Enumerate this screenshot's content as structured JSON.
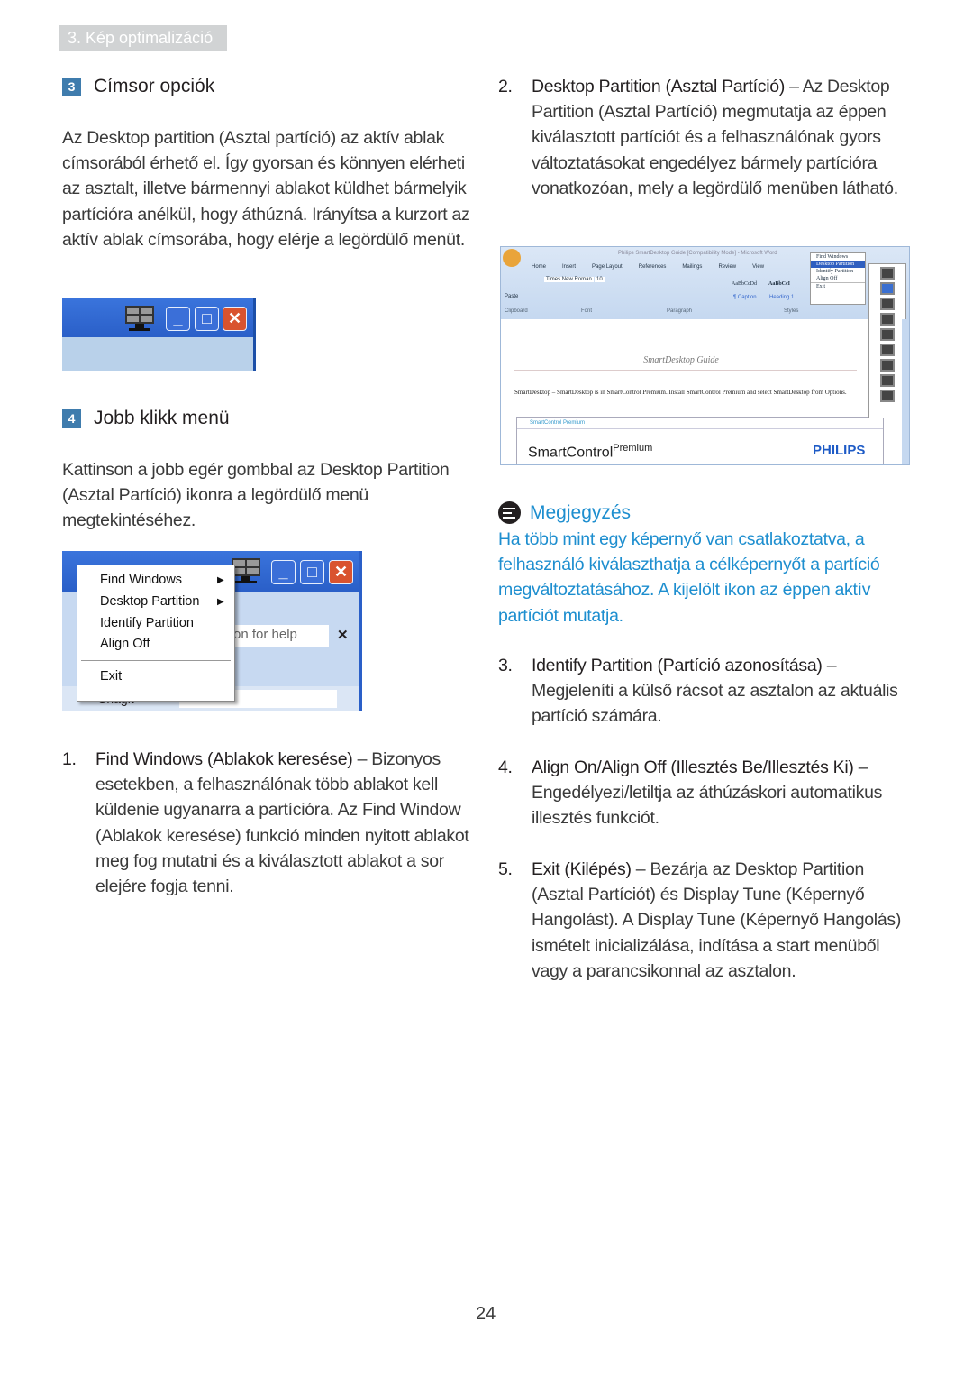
{
  "chapter": "3. Kép optimalizáció",
  "left": {
    "s3": {
      "num": "3",
      "title": "Címsor opciók",
      "body": "Az Desktop partition (Asztal partíció) az aktív ablak címsorából érhető el. Így gyorsan és könnyen elérheti az asztalt, illetve bármennyi ablakot küldhet bármelyik partícióra anélkül, hogy áthúzná. Irányítsa a kurzort az aktív ablak címsorába, hogy elérje a legördülő menüt."
    },
    "s4": {
      "num": "4",
      "title": "Jobb klikk menü",
      "body": "Kattinson a jobb egér gombbal az Desktop Partition (Asztal Partíció) ikonra a legördülő menü megtekintéséhez."
    },
    "menu": {
      "items": [
        "Find Windows",
        "Desktop Partition",
        "Identify Partition",
        "Align Off",
        "Exit"
      ],
      "help": "on for help",
      "snagit": "Snagit",
      "window": "Window"
    },
    "list": [
      {
        "num": "1.",
        "title": "Find Windows (Ablakok keresése)",
        "body": "Bizonyos esetekben, a felhasználónak több ablakot kell küldenie ugyanarra a partícióra. Az Find Window (Ablakok keresése) funkció minden nyitott ablakot meg fog mutatni és a kiválasztott ablakot a sor elejére fogja tenni."
      }
    ]
  },
  "right": {
    "list": [
      {
        "num": "2.",
        "title": "Desktop Partition (Asztal Partíció)",
        "body": "Az Desktop Partition (Asztal Partíció) megmutatja az éppen kiválasztott partíciót és a felhasználónak gyors változtatásokat engedélyez bármely partícióra vonatkozóan, mely a legördülő menüben látható."
      },
      {
        "num": "3.",
        "title": "Identify Partition (Partíció azonosítása)",
        "body": "Megjeleníti a külső rácsot az asztalon az aktuális partíció számára."
      },
      {
        "num": "4.",
        "title": "Align On/Align Off (Illesztés Be/Illesztés Ki)",
        "body": "Engedélyezi/letiltja az áthúzáskori automatikus illesztés funkciót."
      },
      {
        "num": "5.",
        "title": "Exit (Kilépés)",
        "body": "Bezárja az Desktop Partition (Asztal Partíciót) és Display Tune (Képernyő Hangolást). A Display Tune (Képernyő Hangolás) ismételt inicializálása, indítása a start menüből vagy a parancsikonnal az asztalon."
      }
    ],
    "word": {
      "title": "Philips SmartDesktop Guide [Compatibility Mode] - Microsoft Word",
      "tabs": [
        "Home",
        "Insert",
        "Page Layout",
        "References",
        "Mailings",
        "Review",
        "View"
      ],
      "font": "Times New Roman",
      "size": "10",
      "groups": [
        "Clipboard",
        "Font",
        "Paragraph",
        "Styles"
      ],
      "styles": [
        "AaBbCcDd",
        "AaBbCcI"
      ],
      "style_names": [
        "¶ Caption",
        "Heading 1"
      ],
      "paste": "Paste",
      "menu": [
        "Find Windows",
        "Desktop Partition",
        "Identify Partition",
        "Align Off",
        "Exit"
      ],
      "doc_title": "SmartDesktop Guide",
      "doc_text": "SmartDesktop – SmartDesktop is in SmartControl Premium. Install SmartControl Premium and select SmartDesktop from Options.",
      "sc_title": "SmartControl Premium",
      "sc_brand": "SmartControl",
      "sc_premium": "Premium",
      "philips": "PHILIPS"
    },
    "note": {
      "title": "Megjegyzés",
      "body": "Ha több mint egy képernyő van csatlakoztatva, a felhasználó kiválaszthatja a célképernyőt a partíció megváltoztatásához. A kijelölt ikon az éppen aktív partíciót mutatja."
    }
  },
  "page_number": "24",
  "colors": {
    "accent": "#3f7cad",
    "note": "#1d8ecf",
    "chapter_bg": "#d1d3d4"
  }
}
